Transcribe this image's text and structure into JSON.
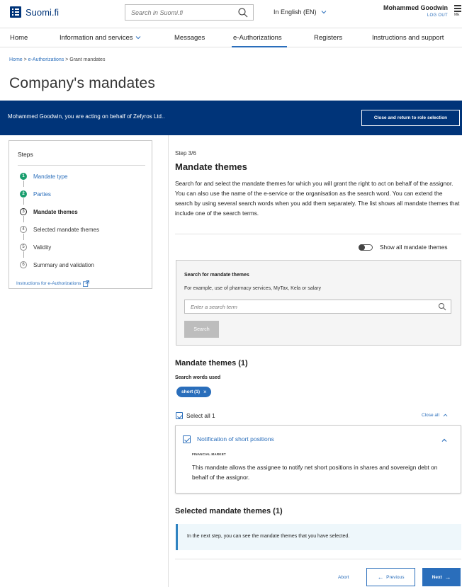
{
  "header": {
    "logo_text": "Suomi.fi",
    "search_placeholder": "Search in Suomi.fi",
    "language": "In English (EN)",
    "user_name": "Mohammed Goodwin",
    "logout": "LOG OUT",
    "menu_label": "ME"
  },
  "nav": {
    "items": [
      {
        "label": "Home"
      },
      {
        "label": "Information and services"
      },
      {
        "label": "Messages"
      },
      {
        "label": "e-Authorizations"
      },
      {
        "label": "Registers"
      },
      {
        "label": "Instructions and support"
      }
    ],
    "active": "e-Authorizations"
  },
  "breadcrumb": {
    "home": "Home",
    "sep1": " > ",
    "eauth": "e-Authorizations",
    "sep2": " > ",
    "current": "Grant mandates"
  },
  "page": {
    "title": "Company's mandates"
  },
  "banner": {
    "text": "Mohammed Goodwin, you are acting on behalf of Zefyros Ltd..",
    "button": "Close and return to role selection"
  },
  "steps": {
    "title": "Steps",
    "items": [
      {
        "num": "1",
        "label": "Mandate type"
      },
      {
        "num": "2",
        "label": "Parties"
      },
      {
        "num": "3",
        "label": "Mandate themes"
      },
      {
        "num": "4",
        "label": "Selected mandate themes"
      },
      {
        "num": "5",
        "label": "Validity"
      },
      {
        "num": "6",
        "label": "Summary and validation"
      }
    ],
    "instructions": "Instructions for e-Authorizations"
  },
  "main": {
    "step_label": "Step 3/6",
    "heading": "Mandate themes",
    "description": "Search for and select the mandate themes for which you will grant the right to act on behalf of the assignor. You can also use the name of the e-service or the organisation as the search word. You can extend the search by using several search words when you add them separately. The list shows all mandate themes that include one of the search terms.",
    "toggle_label": "Show all mandate themes"
  },
  "search": {
    "title": "Search for mandate themes",
    "hint": "For example, use of pharmacy services, MyTax, Kela or salary",
    "placeholder": "Enter a search term",
    "button": "Search"
  },
  "results": {
    "heading": "Mandate themes (1)",
    "search_words_label": "Search words used",
    "chip": "short (1)",
    "chip_remove": "×",
    "select_all": "Select all 1",
    "close_all": "Close all",
    "card": {
      "title": "Notification of short positions",
      "category": "FINANCIAL MARKET",
      "description": "This mandate allows the assignee to notify net short positions in shares and sovereign debt on behalf of the assignor."
    }
  },
  "selected": {
    "heading": "Selected mandate themes (1)",
    "info": "In the next step, you can see the mandate themes that you have selected."
  },
  "footer": {
    "abort": "Abort",
    "previous": "Previous",
    "next": "Next",
    "prev_arrow": "←",
    "next_arrow": "→"
  },
  "colors": {
    "brand_dark": "#003479",
    "link": "#2a6ebb",
    "done_step": "#1a9e6e"
  }
}
